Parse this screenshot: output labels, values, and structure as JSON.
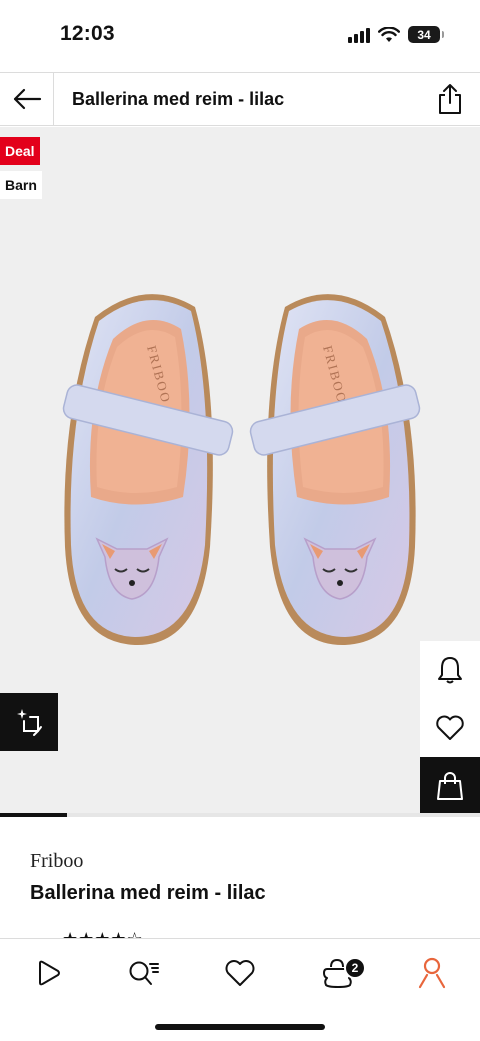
{
  "status_bar": {
    "time": "12:03",
    "battery": "34"
  },
  "header": {
    "title": "Ballerina med reim - lilac"
  },
  "badges": {
    "deal": "Deal",
    "category": "Barn"
  },
  "product_image": {
    "shoe_brand_print": "FRIBOO",
    "gallery_progress": 0.14
  },
  "product": {
    "brand": "Friboo",
    "name": "Ballerina med reim - lilac",
    "rating_peek": "★★★★☆"
  },
  "bottom_nav": {
    "cart_count": "2"
  },
  "colors": {
    "accent_orange": "#e8663c",
    "deal_red": "#e3001b",
    "shoe_lilac": "#c8d0e8"
  },
  "icons": [
    "arrow-left-icon",
    "share-icon",
    "ar-view-icon",
    "bell-icon",
    "heart-icon",
    "shopping-bag-icon",
    "play-icon",
    "search-list-icon",
    "heart-icon",
    "cart-icon",
    "user-icon"
  ]
}
